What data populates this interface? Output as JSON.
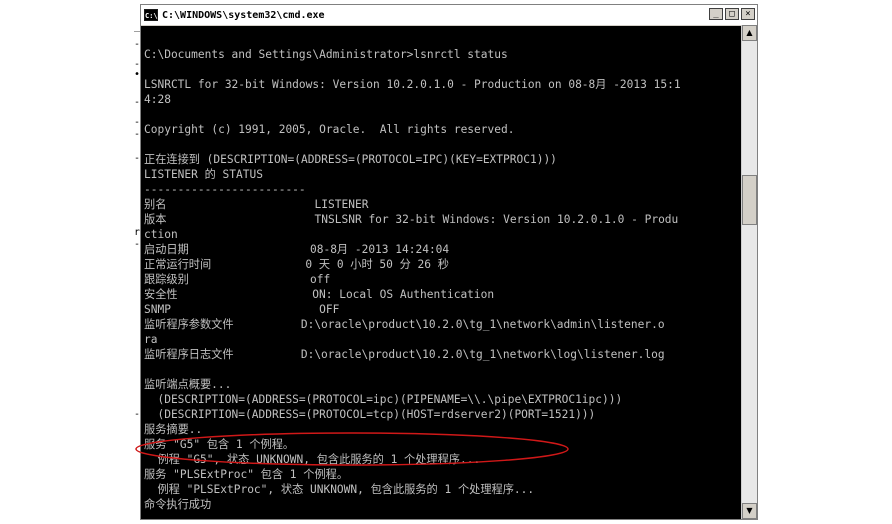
{
  "window": {
    "title": "C:\\WINDOWS\\system32\\cmd.exe",
    "icon_label": "C:\\",
    "minimize": "_",
    "maximize": "□",
    "close": "×"
  },
  "console_lines": [
    "",
    "C:\\Documents and Settings\\Administrator>lsnrctl status",
    "",
    "LSNRCTL for 32-bit Windows: Version 10.2.0.1.0 - Production on 08-8月 -2013 15:1",
    "4:28",
    "",
    "Copyright (c) 1991, 2005, Oracle.  All rights reserved.",
    "",
    "正在连接到 (DESCRIPTION=(ADDRESS=(PROTOCOL=IPC)(KEY=EXTPROC1)))",
    "LISTENER 的 STATUS",
    "------------------------",
    "别名                      LISTENER",
    "版本                      TNSLSNR for 32-bit Windows: Version 10.2.0.1.0 - Produ",
    "ction",
    "启动日期                  08-8月 -2013 14:24:04",
    "正常运行时间              0 天 0 小时 50 分 26 秒",
    "跟踪级别                  off",
    "安全性                    ON: Local OS Authentication",
    "SNMP                      OFF",
    "监听程序参数文件          D:\\oracle\\product\\10.2.0\\tg_1\\network\\admin\\listener.o",
    "ra",
    "监听程序日志文件          D:\\oracle\\product\\10.2.0\\tg_1\\network\\log\\listener.log",
    "",
    "监听端点概要...",
    "  (DESCRIPTION=(ADDRESS=(PROTOCOL=ipc)(PIPENAME=\\\\.\\pipe\\EXTPROC1ipc)))",
    "  (DESCRIPTION=(ADDRESS=(PROTOCOL=tcp)(HOST=rdserver2)(PORT=1521)))",
    "服务摘要..",
    "服务 \"G5\" 包含 1 个例程。",
    "  例程 \"G5\", 状态 UNKNOWN, 包含此服务的 1 个处理程序...",
    "服务 \"PLSExtProc\" 包含 1 个例程。",
    "  例程 \"PLSExtProc\", 状态 UNKNOWN, 包含此服务的 1 个处理程序...",
    "命令执行成功"
  ],
  "scrollbar": {
    "up": "▲",
    "down": "▼"
  },
  "margin_marks": [
    "_",
    "-",
    "-",
    "•",
    "-",
    "-",
    "-",
    "-",
    "r",
    "-",
    "-"
  ],
  "annotation": {
    "color": "#d01818"
  }
}
